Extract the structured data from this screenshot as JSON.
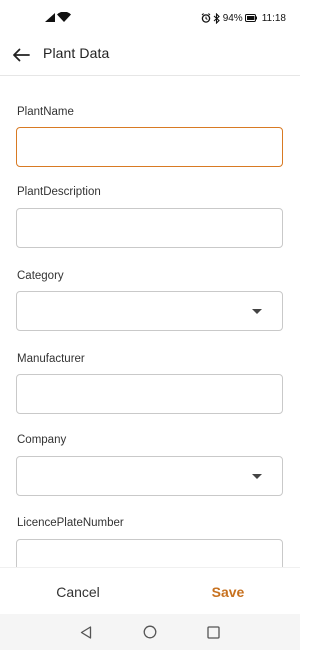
{
  "status_bar": {
    "battery": "94%",
    "time": "11:18",
    "icons": [
      "signal-icon",
      "wifi-icon",
      "alarm-icon",
      "bluetooth-icon",
      "battery-icon"
    ]
  },
  "app_bar": {
    "back_icon": "arrow-left-icon",
    "title": "Plant Data"
  },
  "form": {
    "fields": [
      {
        "label": "PlantName",
        "type": "text",
        "value": "",
        "focused": true
      },
      {
        "label": "PlantDescription",
        "type": "text",
        "value": ""
      },
      {
        "label": "Category",
        "type": "dropdown",
        "value": ""
      },
      {
        "label": "Manufacturer",
        "type": "text",
        "value": ""
      },
      {
        "label": "Company",
        "type": "dropdown",
        "value": ""
      },
      {
        "label": "LicencePlateNumber",
        "type": "text",
        "value": ""
      }
    ]
  },
  "actions": {
    "cancel_label": "Cancel",
    "save_label": "Save"
  },
  "colors": {
    "accent": "#d87a23",
    "save_text": "#c7711f"
  },
  "nav_bar": {
    "icons": [
      "back-triangle-icon",
      "home-circle-icon",
      "recents-square-icon"
    ]
  }
}
